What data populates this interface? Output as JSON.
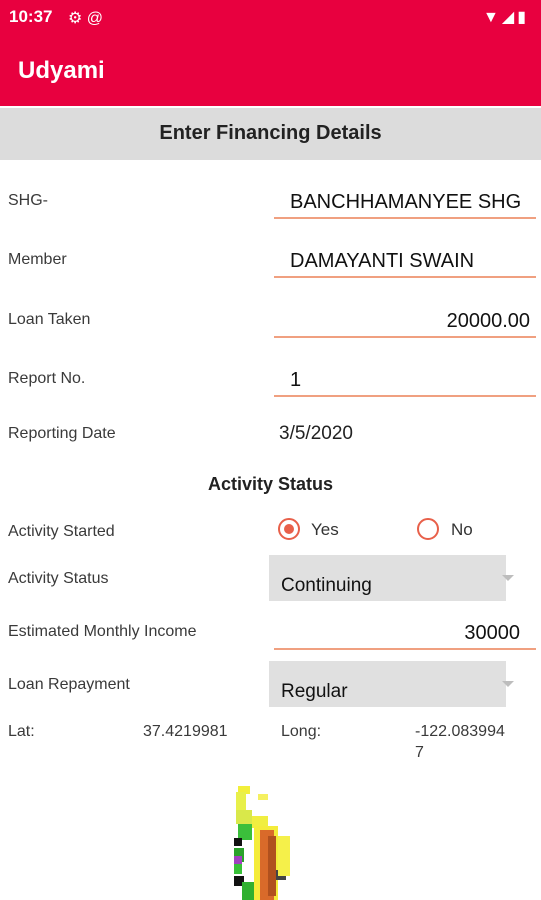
{
  "status_bar": {
    "time": "10:37",
    "icons_left": [
      "gear-icon",
      "at-icon"
    ],
    "icons_right": [
      "wifi-icon",
      "signal-icon",
      "battery-icon"
    ]
  },
  "app": {
    "title": "Udyami",
    "accent_color": "#e8003f"
  },
  "header": {
    "title": "Enter Financing Details"
  },
  "fields": {
    "shg": {
      "label": "SHG-",
      "value": "BANCHHAMANYEE SHG"
    },
    "member": {
      "label": "Member",
      "value": "DAMAYANTI SWAIN"
    },
    "loan_taken": {
      "label": "Loan Taken",
      "value": "20000.00"
    },
    "report_no": {
      "label": "Report No.",
      "value": "1"
    },
    "reporting_date": {
      "label": "Reporting Date",
      "value": "3/5/2020"
    }
  },
  "activity": {
    "section_title": "Activity Status",
    "started": {
      "label": "Activity Started",
      "options": [
        "Yes",
        "No"
      ],
      "selected": "Yes"
    },
    "status": {
      "label": "Activity Status",
      "value": "Continuing"
    },
    "monthly_income": {
      "label": "Estimated Monthly Income",
      "value": "30000"
    },
    "repayment": {
      "label": "Loan Repayment",
      "value": "Regular"
    }
  },
  "location": {
    "lat_label": "Lat:",
    "lat_value": "37.4219981",
    "long_label": "Long:",
    "long_value_line1": "-122.083994",
    "long_value_line2": "7"
  }
}
